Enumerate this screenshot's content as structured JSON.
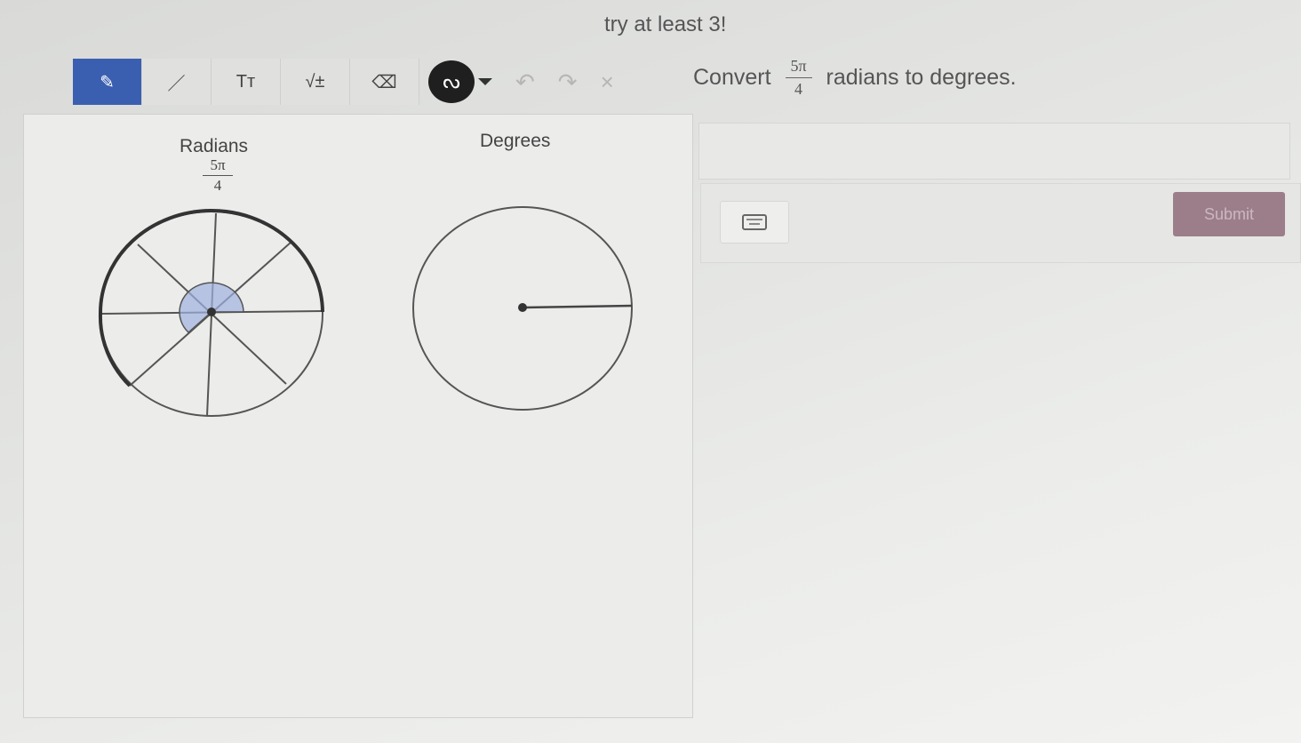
{
  "note": "try at least 3!",
  "toolbar": {
    "tools": [
      {
        "name": "pen-tool",
        "glyph": "✎"
      },
      {
        "name": "line-tool",
        "glyph": "／"
      },
      {
        "name": "text-tool",
        "glyph": "Tт"
      },
      {
        "name": "math-tool",
        "glyph": "√±"
      },
      {
        "name": "eraser-tool",
        "glyph": "⌫"
      }
    ],
    "color_glyph": "ᔓ",
    "undo_glyph": "↶",
    "redo_glyph": "↷",
    "clear_glyph": "×"
  },
  "prompt": {
    "prefix": "Convert",
    "numerator": "5π",
    "denominator": "4",
    "suffix": "radians to degrees."
  },
  "canvas": {
    "radians_label": "Radians",
    "radians_numerator": "5π",
    "radians_denominator": "4",
    "degrees_label": "Degrees"
  },
  "submit_label": "Submit",
  "colors": {
    "active_tool": "#3b5fb0",
    "angle_fill": "#9fb0e0",
    "submit": "#9c7e8a"
  }
}
